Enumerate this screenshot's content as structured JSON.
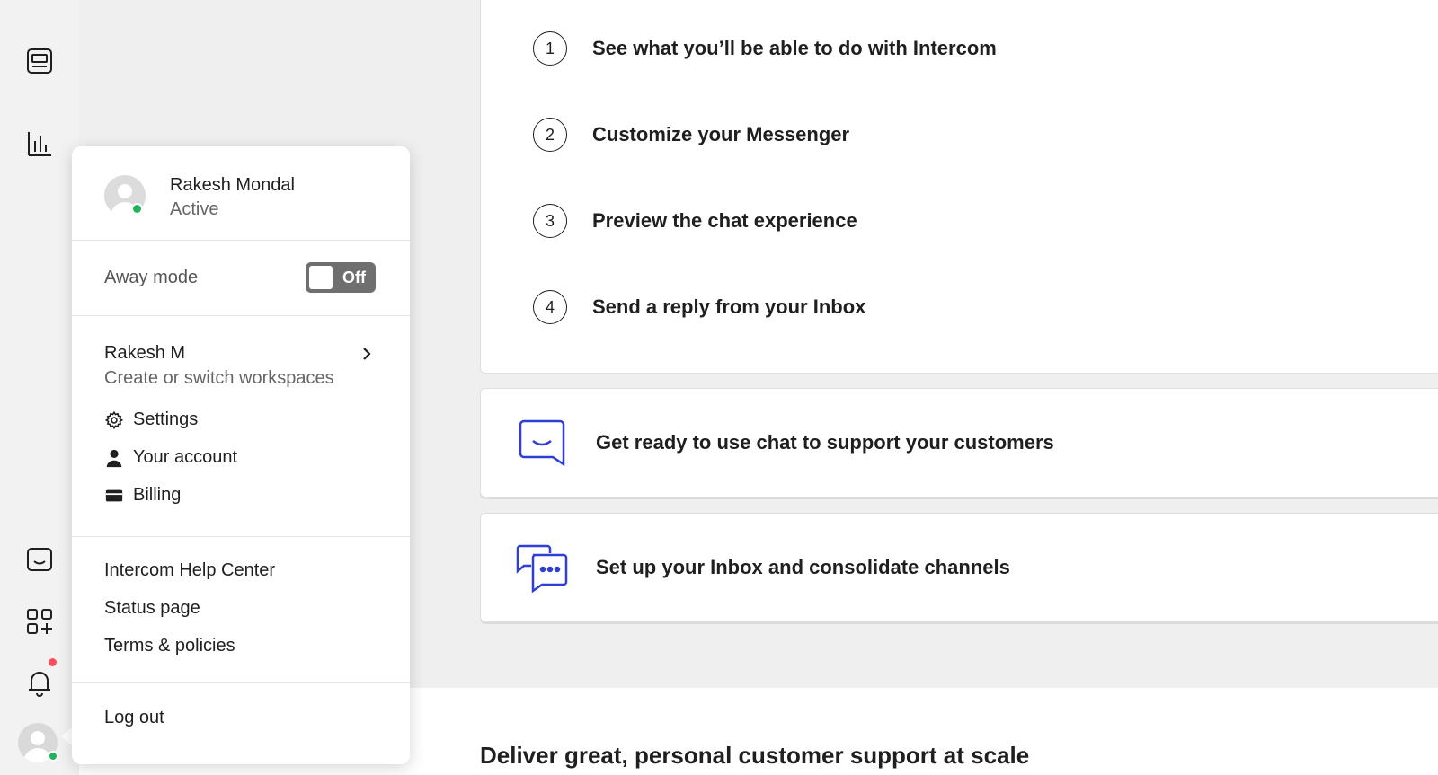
{
  "sidebar": {
    "icons": [
      "inbox-icon",
      "reports-icon",
      "messenger-icon",
      "apps-icon",
      "notifications-icon"
    ],
    "notification_dot_color": "#ff4d5e",
    "online_dot_color": "#1fb35c"
  },
  "menu": {
    "profile": {
      "name": "Rakesh Mondal",
      "status": "Active"
    },
    "away_mode": {
      "label": "Away mode",
      "toggle_text": "Off"
    },
    "workspace": {
      "name": "Rakesh M",
      "subtitle": "Create or switch workspaces"
    },
    "account_items": [
      {
        "label": "Settings",
        "icon": "gear-icon"
      },
      {
        "label": "Your account",
        "icon": "user-icon"
      },
      {
        "label": "Billing",
        "icon": "credit-card-icon"
      }
    ],
    "help_items": [
      "Intercom Help Center",
      "Status page",
      "Terms & policies"
    ],
    "logout": "Log out"
  },
  "main": {
    "steps": [
      {
        "num": "1",
        "text": "See what you’ll be able to do with Intercom"
      },
      {
        "num": "2",
        "text": "Customize your Messenger"
      },
      {
        "num": "3",
        "text": "Preview the chat experience"
      },
      {
        "num": "4",
        "text": "Send a reply from your Inbox"
      }
    ],
    "tasks": [
      {
        "text": "Get ready to use chat to support your customers",
        "icon": "chat-smile-icon"
      },
      {
        "text": "Set up your Inbox and consolidate channels",
        "icon": "chat-bubbles-icon"
      }
    ],
    "bottom_heading": "Deliver great, personal customer support at scale",
    "accent_color": "#2f3fd6"
  }
}
